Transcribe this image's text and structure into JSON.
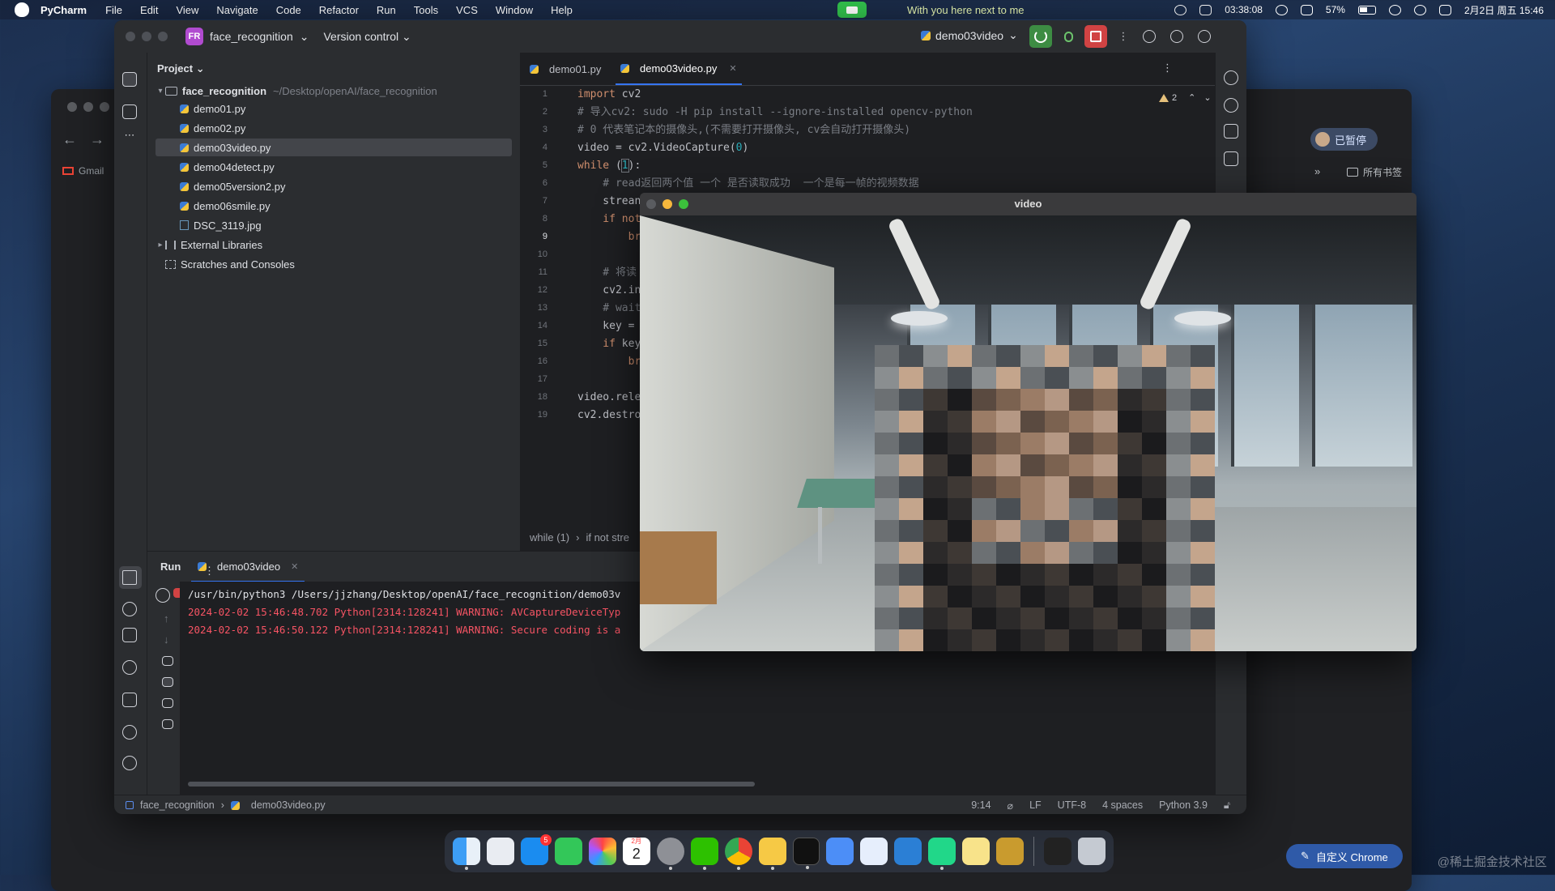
{
  "menubar": {
    "app": "PyCharm",
    "items": [
      "File",
      "Edit",
      "View",
      "Navigate",
      "Code",
      "Refactor",
      "Run",
      "Tools",
      "VCS",
      "Window",
      "Help"
    ],
    "now_playing": "With you here next to me",
    "timer": "03:38:08",
    "battery": "57%",
    "datetime": "2月2日 周五 15:46"
  },
  "ide": {
    "project_badge": "FR",
    "project_name": "face_recognition",
    "version_control": "Version control",
    "run_config": "demo03video",
    "project_pane": {
      "header": "Project",
      "root": "face_recognition",
      "root_path": "~/Desktop/openAI/face_recognition",
      "files": [
        "demo01.py",
        "demo02.py",
        "demo03video.py",
        "demo04detect.py",
        "demo05version2.py",
        "demo06smile.py",
        "DSC_3119.jpg"
      ],
      "external": "External Libraries",
      "scratches": "Scratches and Consoles"
    },
    "tabs": [
      "demo01.py",
      "demo03video.py"
    ],
    "warnings": "2",
    "line_numbers": [
      "1",
      "2",
      "3",
      "4",
      "5",
      "6",
      "7",
      "8",
      "9",
      "10",
      "11",
      "12",
      "13",
      "14",
      "15",
      "16",
      "17",
      "18",
      "19"
    ],
    "code": {
      "l1_kw": "import",
      "l1_rest": " cv2",
      "l2": "# 导入cv2: sudo -H pip install --ignore-installed opencv-python",
      "l3": "# 0 代表笔记本的摄像头,(不需要打开摄像头, cv会自动打开摄像头)",
      "l4_a": "video = cv2.VideoCapture(",
      "l4_num": "0",
      "l4_b": ")",
      "l5_kw": "while",
      "l5_a": " (",
      "l5_num": "1",
      "l5_b": "):",
      "l6": "    # read返回两个值 一个 是否读取成功  一个是每一帧的视频数据",
      "l7": "    strean",
      "l8_kw": "    if",
      "l8_rest": " not",
      "l9": "        br",
      "l11": "    # 将读",
      "l12": "    cv2.in",
      "l13": "    # wait",
      "l14": "    key =",
      "l15_kw": "    if",
      "l15_rest": " key",
      "l16": "        br",
      "l18": "video.rele",
      "l19": "cv2.destro"
    },
    "breadcrumb": [
      "while (1)",
      "if not stre"
    ],
    "run": {
      "title": "Run",
      "tab": "demo03video",
      "lines": [
        "/usr/bin/python3 /Users/jjzhang/Desktop/openAI/face_recognition/demo03v",
        "2024-02-02 15:46:48.702 Python[2314:128241] WARNING: AVCaptureDeviceTyp",
        "2024-02-02 15:46:50.122 Python[2314:128241] WARNING: Secure coding is a"
      ]
    },
    "status": {
      "crumb_project": "face_recognition",
      "crumb_file": "demo03video.py",
      "position": "9:14",
      "line_sep": "LF",
      "encoding": "UTF-8",
      "indent": "4 spaces",
      "interpreter": "Python 3.9"
    }
  },
  "video_window": {
    "title": "video"
  },
  "chrome": {
    "bookmark_gmail": "Gmail",
    "profile_status": "已暂停",
    "bookmarks": "所有书签",
    "customize": "自定义 Chrome"
  },
  "dock": {
    "notification_count": "5",
    "calendar_month": "2月",
    "calendar_day": "2"
  },
  "watermark": "@稀土掘金技术社区",
  "colors": {
    "accent": "#3574f0",
    "run_green": "#3d8c43",
    "stop_red": "#d14343",
    "error_text": "#f75464"
  }
}
